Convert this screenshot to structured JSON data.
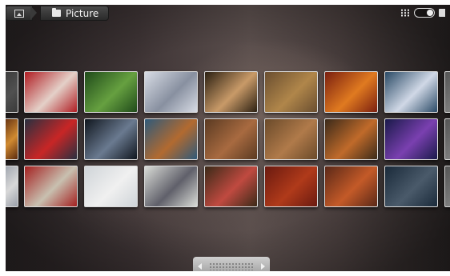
{
  "breadcrumb": {
    "app_icon": "gallery-icon",
    "folder_icon": "folder-icon",
    "folder_label": "Picture"
  },
  "controls": {
    "grid_icon": "grid-view-icon",
    "toggle_icon": "view-toggle-icon",
    "slideshow_icon": "slideshow-icon"
  },
  "thumbnails": [
    {
      "row": 1,
      "col": 0,
      "colors": [
        "#3a3a3a",
        "#505050"
      ]
    },
    {
      "row": 1,
      "col": 1,
      "colors": [
        "#b01c22",
        "#e4d0c8"
      ]
    },
    {
      "row": 1,
      "col": 2,
      "colors": [
        "#1f4a1a",
        "#66a040"
      ]
    },
    {
      "row": 1,
      "col": 3,
      "colors": [
        "#d7dbe4",
        "#8890a0"
      ]
    },
    {
      "row": 1,
      "col": 4,
      "colors": [
        "#2b2012",
        "#c89a68"
      ]
    },
    {
      "row": 1,
      "col": 5,
      "colors": [
        "#6a4e30",
        "#b0864a"
      ]
    },
    {
      "row": 1,
      "col": 6,
      "colors": [
        "#7a1f10",
        "#e07a20"
      ]
    },
    {
      "row": 1,
      "col": 7,
      "colors": [
        "#2a4a66",
        "#d0d8e6"
      ]
    },
    {
      "row": 2,
      "col": 0,
      "colors": [
        "#5a2a10",
        "#d08a30"
      ]
    },
    {
      "row": 2,
      "col": 1,
      "colors": [
        "#283040",
        "#c82626"
      ]
    },
    {
      "row": 2,
      "col": 2,
      "colors": [
        "#10161e",
        "#6a7a90"
      ]
    },
    {
      "row": 2,
      "col": 3,
      "colors": [
        "#2f5a7a",
        "#b26a30"
      ]
    },
    {
      "row": 2,
      "col": 4,
      "colors": [
        "#5a3a22",
        "#a86a40"
      ]
    },
    {
      "row": 2,
      "col": 5,
      "colors": [
        "#6a4a2a",
        "#b07a4a"
      ]
    },
    {
      "row": 2,
      "col": 6,
      "colors": [
        "#3a2a1a",
        "#c06a2a"
      ]
    },
    {
      "row": 2,
      "col": 7,
      "colors": [
        "#1a1a4a",
        "#7a40b0"
      ]
    },
    {
      "row": 3,
      "col": 0,
      "colors": [
        "#9aa0aa",
        "#d8d8d8"
      ]
    },
    {
      "row": 3,
      "col": 1,
      "colors": [
        "#a42020",
        "#c8c0b0"
      ]
    },
    {
      "row": 3,
      "col": 2,
      "colors": [
        "#cfd4d8",
        "#f0f0f0"
      ]
    },
    {
      "row": 3,
      "col": 3,
      "colors": [
        "#d9dbd6",
        "#60606a"
      ]
    },
    {
      "row": 3,
      "col": 4,
      "colors": [
        "#3a2a18",
        "#c04a40"
      ]
    },
    {
      "row": 3,
      "col": 5,
      "colors": [
        "#6a1a10",
        "#b03a1a"
      ]
    },
    {
      "row": 3,
      "col": 6,
      "colors": [
        "#5a2818",
        "#c45a28"
      ]
    },
    {
      "row": 3,
      "col": 7,
      "colors": [
        "#1a2a3a",
        "#4a5a6a"
      ]
    }
  ],
  "scroller": {
    "left_icon": "scroll-left-icon",
    "right_icon": "scroll-right-icon"
  }
}
